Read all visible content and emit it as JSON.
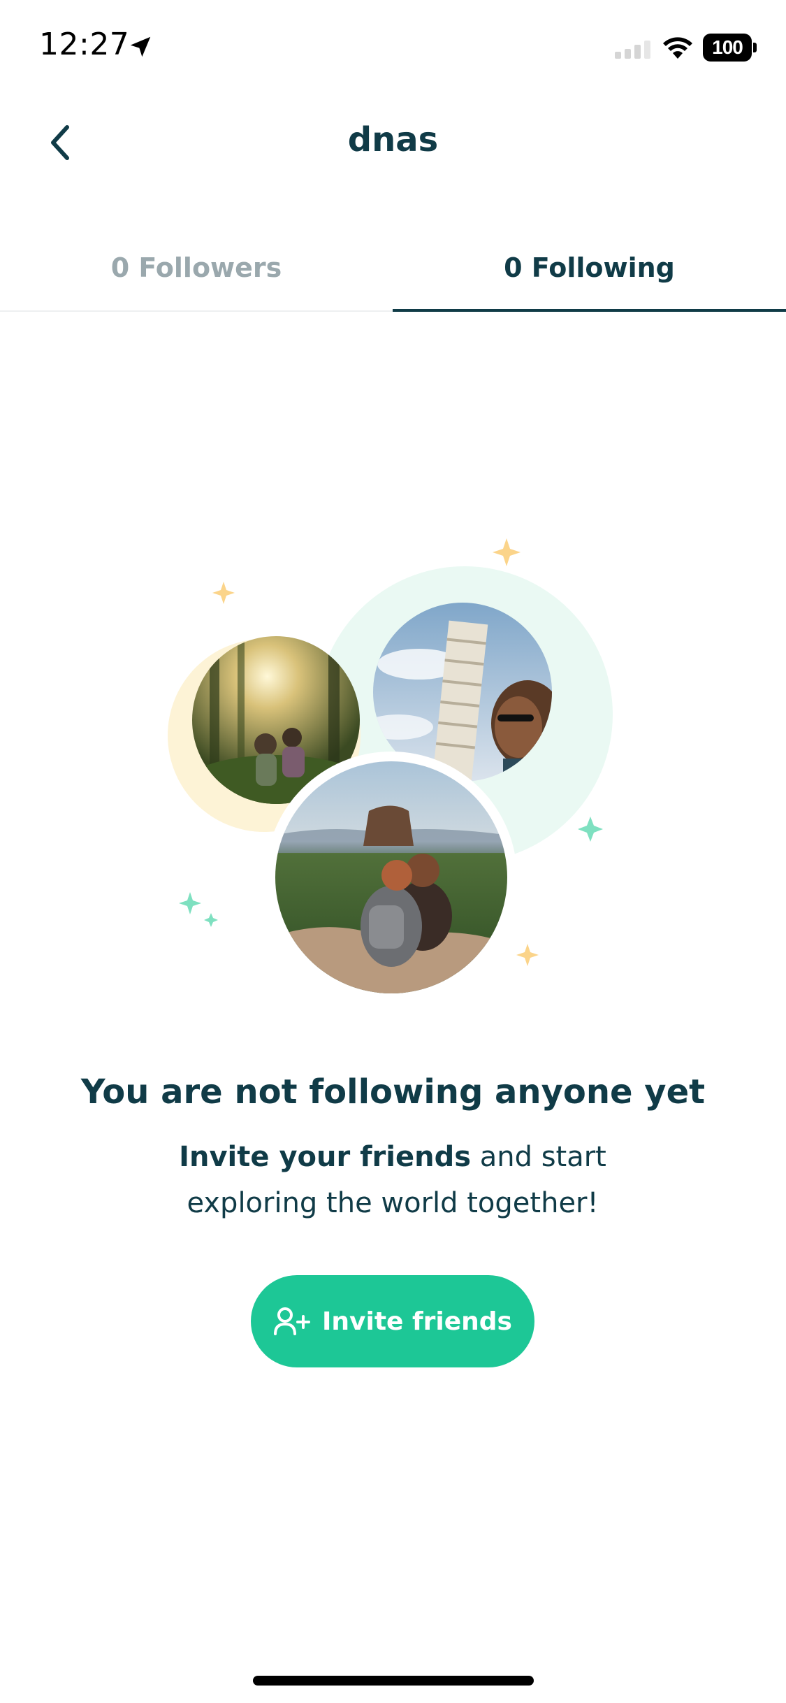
{
  "status_bar": {
    "time": "12:27",
    "battery": "100",
    "icons": [
      "location-arrow-icon",
      "cellular-signal-icon",
      "wifi-icon",
      "battery-icon"
    ]
  },
  "header": {
    "title": "dnas",
    "back_icon": "chevron-left-icon"
  },
  "tabs": [
    {
      "label": "0 Followers",
      "selected": false
    },
    {
      "label": "0 Following",
      "selected": true
    }
  ],
  "empty_state": {
    "title": "You are not following anyone yet",
    "description_bold": "Invite your friends",
    "description_rest_line1": " and start",
    "description_line2": "exploring the world together!",
    "illustration_photos": [
      "forest-hikers-photo",
      "leaning-tower-selfie-photo",
      "sigiriya-rock-couple-photo"
    ]
  },
  "invite_button": {
    "label": "Invite friends",
    "icon": "add-user-icon"
  },
  "colors": {
    "primary_text": "#103b47",
    "muted_text": "#9aa8ad",
    "accent": "#1dc796",
    "sparkle_yellow": "#fbd48a",
    "sparkle_green": "#7ee0c0",
    "halo_yellow": "#fdf3d6",
    "halo_green": "#eaf9f3"
  }
}
